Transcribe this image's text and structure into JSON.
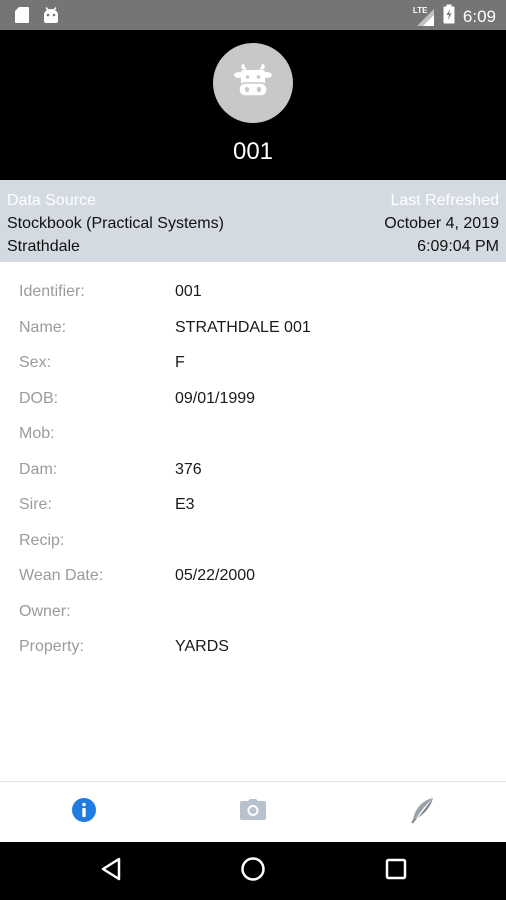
{
  "status_bar": {
    "time": "6:09",
    "network": "LTE",
    "left_icons": [
      "sd-card-icon",
      "android-icon"
    ],
    "right_icons": [
      "signal-icon",
      "battery-icon"
    ]
  },
  "header": {
    "title": "001",
    "avatar_icon": "cow-icon"
  },
  "source": {
    "source_heading": "Data Source",
    "source_line1": "Stockbook (Practical Systems)",
    "source_line2": "Strathdale",
    "refreshed_heading": "Last Refreshed",
    "refreshed_date": "October 4, 2019",
    "refreshed_time": "6:09:04 PM"
  },
  "details": [
    {
      "label": "Identifier:",
      "value": "001"
    },
    {
      "label": "Name:",
      "value": "STRATHDALE 001"
    },
    {
      "label": "Sex:",
      "value": "F"
    },
    {
      "label": "DOB:",
      "value": "09/01/1999"
    },
    {
      "label": "Mob:",
      "value": ""
    },
    {
      "label": "Dam:",
      "value": "376"
    },
    {
      "label": "Sire:",
      "value": "E3"
    },
    {
      "label": "Recip:",
      "value": ""
    },
    {
      "label": "Wean Date:",
      "value": "05/22/2000"
    },
    {
      "label": "Owner:",
      "value": ""
    },
    {
      "label": "Property:",
      "value": "YARDS"
    }
  ],
  "tabs": [
    {
      "icon": "info-icon",
      "active": true
    },
    {
      "icon": "camera-icon",
      "active": false
    },
    {
      "icon": "feather-icon",
      "active": false
    }
  ],
  "colors": {
    "status_bar": "#757575",
    "header_bg": "#000000",
    "source_band": "#d3dae1",
    "active_tab": "#1e7be2",
    "inactive_tab": "#b8c2cc",
    "label_gray": "#9b9b9b"
  }
}
